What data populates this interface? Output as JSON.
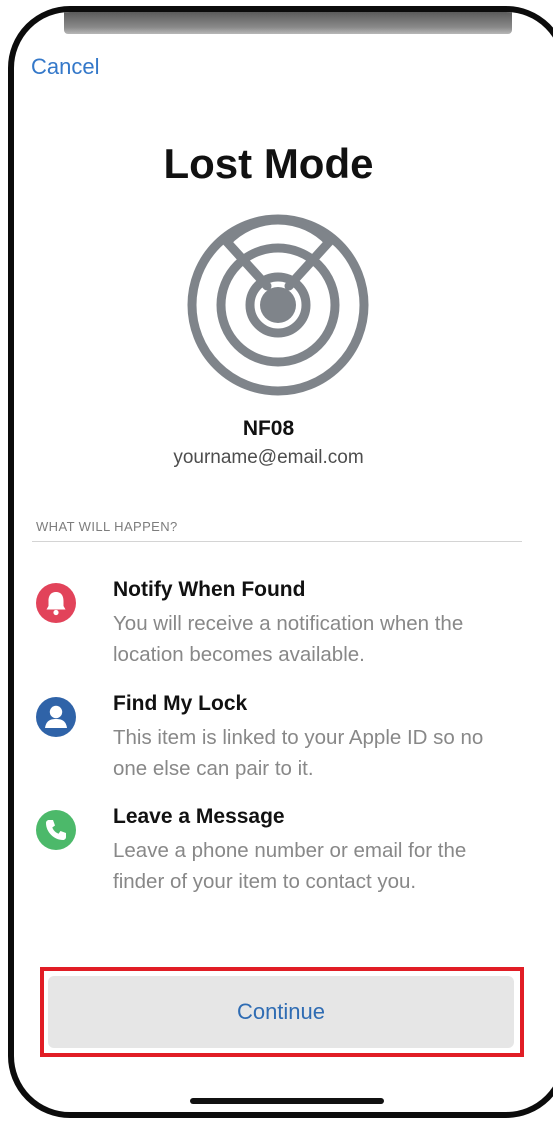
{
  "header": {
    "cancel_label": "Cancel",
    "title": "Lost Mode"
  },
  "device": {
    "name": "NF08",
    "email": "yourname@email.com"
  },
  "section": {
    "header": "WHAT WILL HAPPEN?"
  },
  "features": [
    {
      "title": "Notify When Found",
      "description": "You will receive a notification when the location becomes available.",
      "icon": "bell-icon",
      "color": "#e2435a"
    },
    {
      "title": "Find My Lock",
      "description": "This item is linked to your Apple ID so no one else can pair to it.",
      "icon": "person-icon",
      "color": "#2f63a8"
    },
    {
      "title": "Leave a Message",
      "description": "Leave a phone number or email for the finder of your item to contact you.",
      "icon": "phone-icon",
      "color": "#4cb96a"
    }
  ],
  "actions": {
    "continue_label": "Continue"
  },
  "colors": {
    "accent": "#3478c9",
    "highlight": "#e11d25",
    "graphic": "#7f848a"
  }
}
